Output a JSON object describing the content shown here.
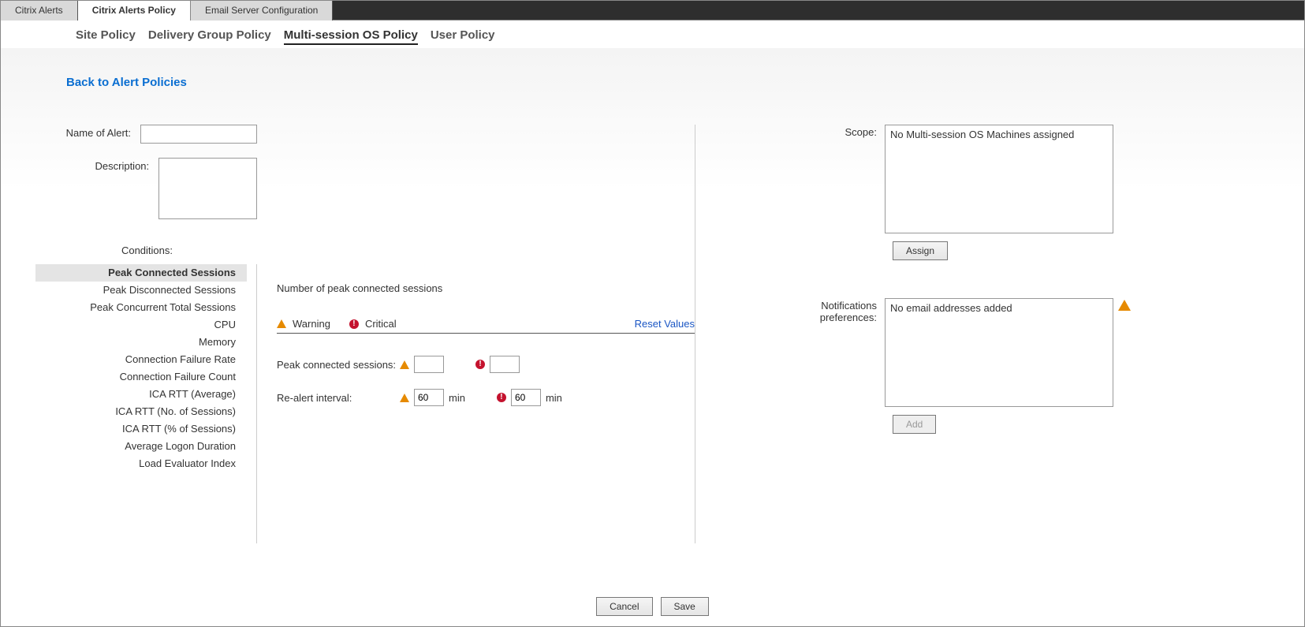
{
  "topTabs": [
    {
      "label": "Citrix Alerts",
      "active": false
    },
    {
      "label": "Citrix Alerts Policy",
      "active": true
    },
    {
      "label": "Email Server Configuration",
      "active": false
    }
  ],
  "subTabs": [
    {
      "label": "Site Policy",
      "active": false
    },
    {
      "label": "Delivery Group Policy",
      "active": false
    },
    {
      "label": "Multi-session OS Policy",
      "active": true
    },
    {
      "label": "User Policy",
      "active": false
    }
  ],
  "backLink": "Back to Alert Policies",
  "labels": {
    "name": "Name of Alert:",
    "description": "Description:",
    "conditions": "Conditions:",
    "scope": "Scope:",
    "notifications": "Notifications preferences:"
  },
  "form": {
    "name": "",
    "description": ""
  },
  "conditionItems": [
    {
      "label": "Peak Connected Sessions",
      "active": true
    },
    {
      "label": "Peak Disconnected Sessions",
      "active": false
    },
    {
      "label": "Peak Concurrent Total Sessions",
      "active": false
    },
    {
      "label": "CPU",
      "active": false
    },
    {
      "label": "Memory",
      "active": false
    },
    {
      "label": "Connection Failure Rate",
      "active": false
    },
    {
      "label": "Connection Failure Count",
      "active": false
    },
    {
      "label": "ICA RTT (Average)",
      "active": false
    },
    {
      "label": "ICA RTT (No. of Sessions)",
      "active": false
    },
    {
      "label": "ICA RTT (% of Sessions)",
      "active": false
    },
    {
      "label": "Average Logon Duration",
      "active": false
    },
    {
      "label": "Load Evaluator Index",
      "active": false
    }
  ],
  "detail": {
    "title": "Number of peak connected sessions",
    "warningLabel": "Warning",
    "criticalLabel": "Critical",
    "resetLabel": "Reset Values",
    "param1Label": "Peak connected sessions:",
    "param1Warn": "",
    "param1Crit": "",
    "param2Label": "Re-alert interval:",
    "param2Warn": "60",
    "param2Crit": "60",
    "unit": "min"
  },
  "scope": {
    "text": "No Multi-session OS Machines assigned",
    "assignBtn": "Assign"
  },
  "notifications": {
    "text": "No email addresses added",
    "addBtn": "Add"
  },
  "footer": {
    "cancel": "Cancel",
    "save": "Save"
  }
}
